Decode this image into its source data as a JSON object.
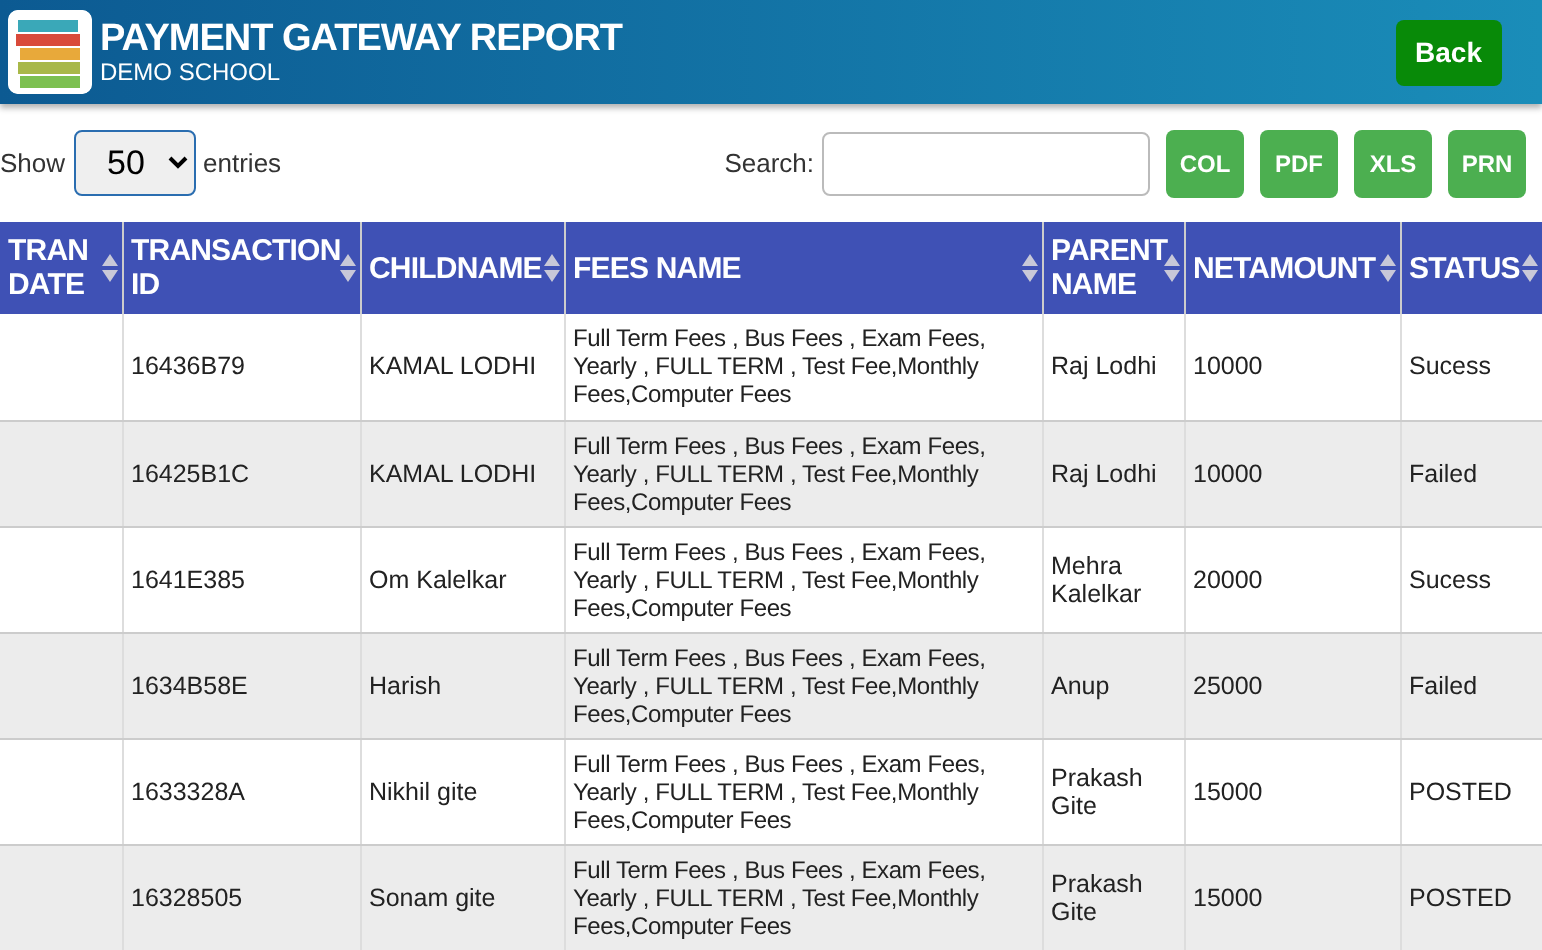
{
  "header": {
    "title": "PAYMENT GATEWAY REPORT",
    "subtitle": "DEMO SCHOOL",
    "back_button": "Back"
  },
  "toolbar": {
    "show_label": "Show",
    "page_size": "50",
    "entries_label": "entries",
    "search_label": "Search:",
    "buttons": [
      "COL",
      "PDF",
      "XLS",
      "PRN"
    ]
  },
  "table": {
    "columns": [
      "TRAN DATE",
      "TRANSACTION ID",
      "CHILDNAME",
      "FEES NAME",
      "PARENT NAME",
      "NETAMOUNT",
      "STATUS"
    ],
    "sortable": [
      true,
      true,
      true,
      true,
      true,
      true,
      true
    ],
    "rows": [
      [
        "",
        "16436B79",
        "KAMAL LODHI",
        "Full Term Fees , Bus Fees , Exam Fees, Yearly , FULL TERM , Test Fee,Monthly Fees,Computer Fees",
        "Raj Lodhi",
        "10000",
        "Sucess"
      ],
      [
        "",
        "16425B1C",
        "KAMAL LODHI",
        "Full Term Fees , Bus Fees , Exam Fees, Yearly , FULL TERM , Test Fee,Monthly Fees,Computer Fees",
        "Raj Lodhi",
        "10000",
        "Failed"
      ],
      [
        "",
        "1641E385",
        "Om Kalelkar",
        "Full Term Fees , Bus Fees , Exam Fees, Yearly , FULL TERM , Test Fee,Monthly Fees,Computer Fees",
        "Mehra Kalelkar",
        "20000",
        "Sucess"
      ],
      [
        "",
        "1634B58E",
        "Harish",
        "Full Term Fees , Bus Fees , Exam Fees, Yearly , FULL TERM , Test Fee,Monthly Fees,Computer Fees",
        "Anup",
        "25000",
        "Failed"
      ],
      [
        "",
        "1633328A",
        "Nikhil gite",
        "Full Term Fees , Bus Fees , Exam Fees, Yearly , FULL TERM , Test Fee,Monthly Fees,Computer Fees",
        "Prakash Gite",
        "15000",
        "POSTED"
      ],
      [
        "",
        "16328505",
        "Sonam gite",
        "Full Term Fees , Bus Fees , Exam Fees, Yearly , FULL TERM , Test Fee,Monthly Fees,Computer Fees",
        "Prakash Gite",
        "15000",
        "POSTED"
      ]
    ]
  }
}
